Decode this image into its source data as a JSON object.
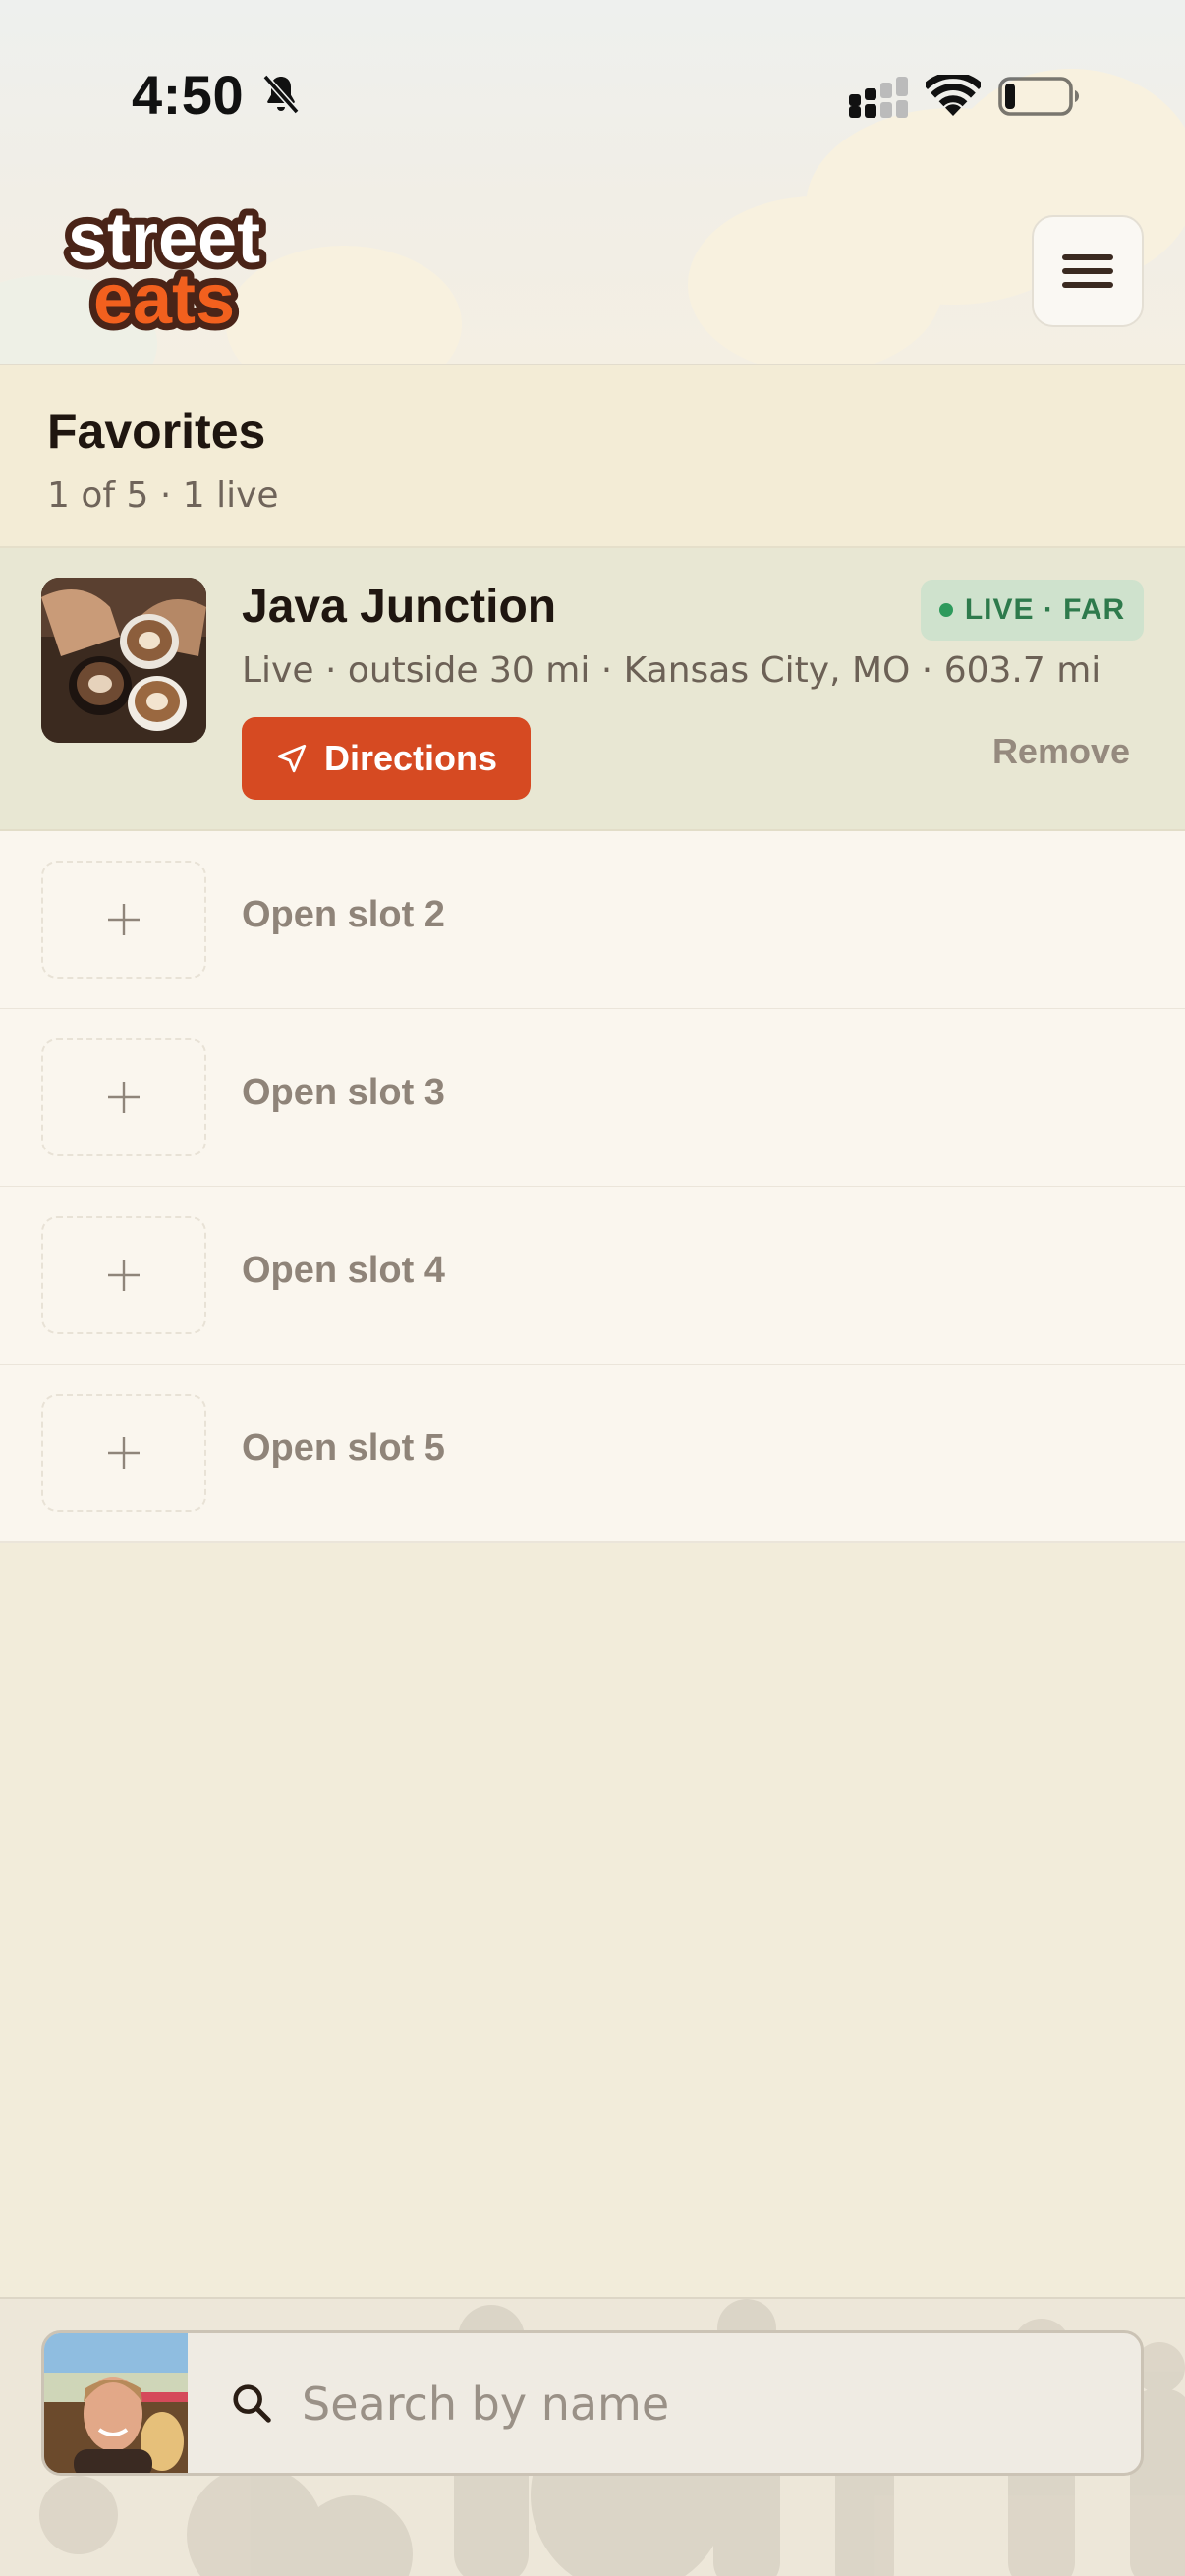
{
  "status_bar": {
    "time": "4:50",
    "icons": [
      "bell-slash-icon",
      "signal-icon",
      "wifi-icon",
      "battery-icon"
    ]
  },
  "header": {
    "logo_text": [
      "street",
      "eats"
    ],
    "menu_icon": "hamburger-menu-icon"
  },
  "favorites": {
    "title": "Favorites",
    "subtitle": "1 of 5 · 1 live",
    "items": [
      {
        "name": "Java Junction",
        "badge": "LIVE · FAR",
        "meta": "Live · outside 30 mi · Kansas City, MO · 603.7 mi",
        "directions_label": "Directions",
        "remove_label": "Remove"
      }
    ],
    "open_slots": [
      "Open slot 2",
      "Open slot 3",
      "Open slot 4",
      "Open slot 5"
    ]
  },
  "search": {
    "placeholder": "Search by name",
    "icon": "search-icon"
  },
  "colors": {
    "accent": "#d64a22",
    "live_green": "#2e7a4c",
    "live_badge_bg": "#cfe2cd",
    "page_bg": "#f2ecda"
  }
}
